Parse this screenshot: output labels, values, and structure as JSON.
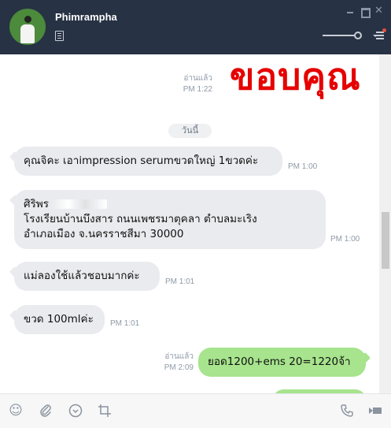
{
  "header": {
    "contact_name": "Phimrampha",
    "icons": {
      "note": "note-icon",
      "minimize": "minimize-icon",
      "maximize": "maximize-icon",
      "close": "close-icon",
      "menu": "menu-icon"
    }
  },
  "overlay": {
    "text": "ขอบคุณ"
  },
  "messages": {
    "m0_status": "อ่านแล้ว",
    "m0_time": "PM 1:22",
    "date_separator": "วันนี้",
    "m1_text": "คุณจิคะ เอาimpression serumขวดใหญ่ 1ขวดค่ะ",
    "m1_time": "PM 1:00",
    "m2_line1": "ศิริพร",
    "m2_line2": "โรงเรียนบ้านบึงสาร ถนนเพชรมาตุคลา ตำบลมะเริง",
    "m2_line3": "อำเภอเมือง จ.นครราชสีมา 30000",
    "m2_time": "PM 1:00",
    "m3_text": "แม่ลองใช้แล้วชอบมากค่ะ",
    "m3_time": "PM 1:01",
    "m4_text": "ขวด 100mlค่ะ",
    "m4_time": "PM 1:01",
    "m5_status": "อ่านแล้ว",
    "m5_time": "PM 2:09",
    "m5_text": "ยอด1200+ems 20=1220จ้า"
  },
  "toolbar": {
    "icons": [
      "emoji-icon",
      "attach-icon",
      "download-icon",
      "crop-icon",
      "phone-icon",
      "video-icon"
    ]
  },
  "colors": {
    "titlebar": "#273244",
    "incoming_bubble": "#e9ebee",
    "outgoing_bubble": "#a7e48d",
    "overlay_text": "#e60000"
  }
}
